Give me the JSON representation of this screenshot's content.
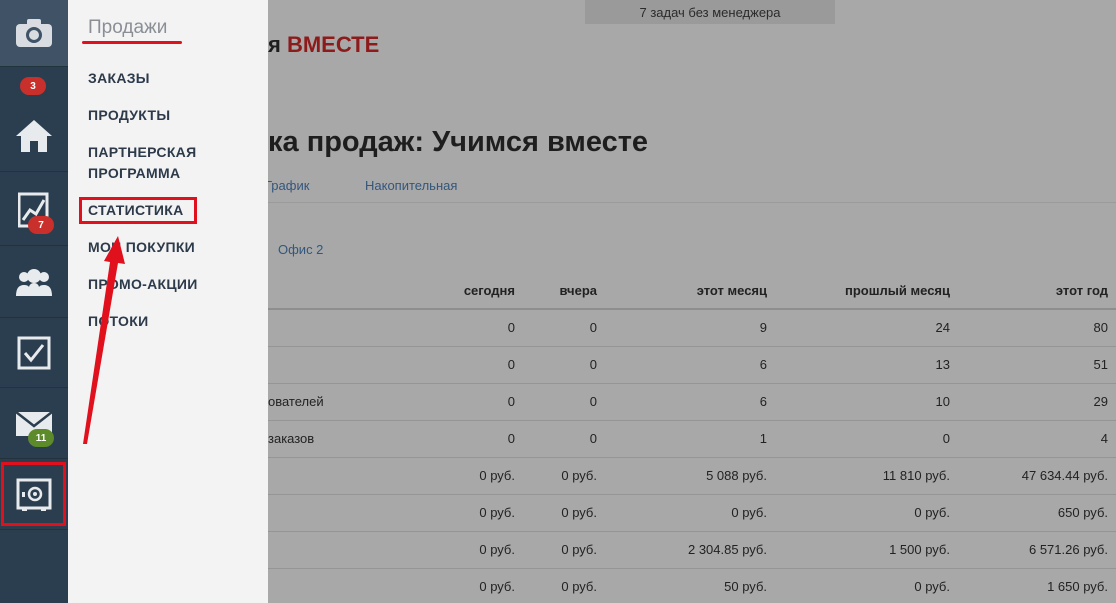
{
  "sidebar": {
    "items": [
      {
        "name": "camera-icon",
        "badge": ""
      },
      {
        "name": "home-icon",
        "badge": "3"
      },
      {
        "name": "chart-icon",
        "badge": "7"
      },
      {
        "name": "users-icon",
        "badge": ""
      },
      {
        "name": "tasks-icon",
        "badge": ""
      },
      {
        "name": "mail-icon",
        "badge": "11"
      },
      {
        "name": "safe-icon",
        "badge": ""
      }
    ],
    "colors": {
      "bg": "#2b3e50",
      "badge_red": "#c9302c",
      "badge_green": "#5d8a2a",
      "highlight": "#e0101d"
    }
  },
  "flyout": {
    "title": "Продажи",
    "items": [
      "ЗАКАЗЫ",
      "ПРОДУКТЫ",
      "ПАРТНЕРСКАЯ ПРОГРАММА",
      "СТАТИСТИКА",
      "МОИ ПОКУПКИ",
      "ПРОМО-АКЦИИ",
      "ПОТОКИ"
    ]
  },
  "header": {
    "tasks_notice": "7 задач без менеджера",
    "logo_text": "я ",
    "logo_accent": "ВМЕСТЕ"
  },
  "page": {
    "title": "ка продаж: Учимся вместе",
    "tabs": [
      "График",
      "Накопительная"
    ],
    "office_link": "Офис 2"
  },
  "table": {
    "headers": [
      "",
      "сегодня",
      "вчера",
      "этот месяц",
      "прошлый месяц",
      "этот год"
    ],
    "rows": [
      [
        "",
        "0",
        "0",
        "9",
        "24",
        "80"
      ],
      [
        "",
        "0",
        "0",
        "6",
        "13",
        "51"
      ],
      [
        "ователей",
        "0",
        "0",
        "6",
        "10",
        "29"
      ],
      [
        "заказов",
        "0",
        "0",
        "1",
        "0",
        "4"
      ],
      [
        "",
        "0 руб.",
        "0 руб.",
        "5 088 руб.",
        "11 810 руб.",
        "47 634.44 руб."
      ],
      [
        "",
        "0 руб.",
        "0 руб.",
        "0 руб.",
        "0 руб.",
        "650 руб."
      ],
      [
        "",
        "0 руб.",
        "0 руб.",
        "2 304.85 руб.",
        "1 500 руб.",
        "6 571.26 руб."
      ],
      [
        "",
        "0 руб.",
        "0 руб.",
        "50 руб.",
        "0 руб.",
        "1 650 руб."
      ]
    ]
  }
}
